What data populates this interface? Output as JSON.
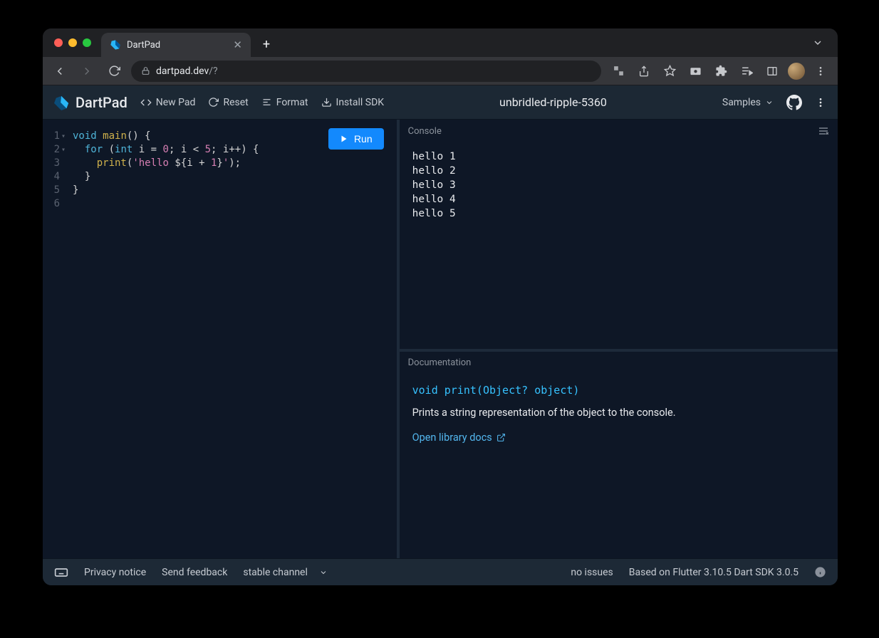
{
  "browser": {
    "tab_title": "DartPad",
    "url_domain": "dartpad.dev",
    "url_path": "/?"
  },
  "header": {
    "logo": "DartPad",
    "new_pad": "New Pad",
    "reset": "Reset",
    "format": "Format",
    "install_sdk": "Install SDK",
    "project_name": "unbridled-ripple-5360",
    "samples": "Samples"
  },
  "editor": {
    "run_label": "Run",
    "line_numbers": [
      "1",
      "2",
      "3",
      "4",
      "5",
      "6"
    ],
    "fold_markers": [
      "▾",
      "▾",
      "",
      "",
      "",
      ""
    ],
    "code_lines_raw": [
      "void main() {",
      "  for (int i = 0; i < 5; i++) {",
      "    print('hello ${i + 1}');",
      "  }",
      "}",
      ""
    ]
  },
  "console": {
    "title": "Console",
    "output": [
      "hello 1",
      "hello 2",
      "hello 3",
      "hello 4",
      "hello 5"
    ]
  },
  "documentation": {
    "title": "Documentation",
    "signature": "void print(Object? object)",
    "description": "Prints a string representation of the object to the console.",
    "link_label": "Open library docs"
  },
  "footer": {
    "privacy": "Privacy notice",
    "feedback": "Send feedback",
    "channel": "stable channel",
    "issues": "no issues",
    "sdk": "Based on Flutter 3.10.5 Dart SDK 3.0.5"
  }
}
